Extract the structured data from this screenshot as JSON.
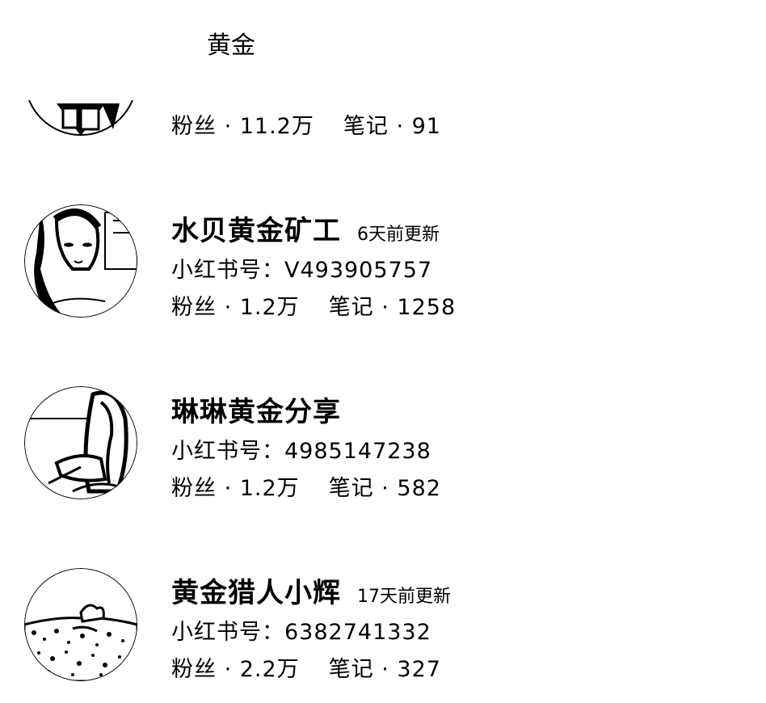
{
  "search_keyword": "黄金",
  "top_partial": {
    "fans": "粉丝 · 11.2万",
    "notes": "笔记 · 91"
  },
  "users": [
    {
      "name": "水贝黄金矿工",
      "updated": "6天前更新",
      "red_id": "小红书号：V493905757",
      "fans": "粉丝 · 1.2万",
      "notes": "笔记 · 1258",
      "avatar_icon": "woman-portrait-avatar"
    },
    {
      "name": "琳琳黄金分享",
      "updated": "",
      "red_id": "小红书号：4985147238",
      "fans": "粉丝 · 1.2万",
      "notes": "笔记 · 582",
      "avatar_icon": "woman-sitting-avatar"
    },
    {
      "name": "黄金猎人小辉",
      "updated": "17天前更新",
      "red_id": "小红书号：6382741332",
      "fans": "粉丝 · 2.2万",
      "notes": "笔记 · 327",
      "avatar_icon": "landscape-rocks-avatar"
    }
  ]
}
